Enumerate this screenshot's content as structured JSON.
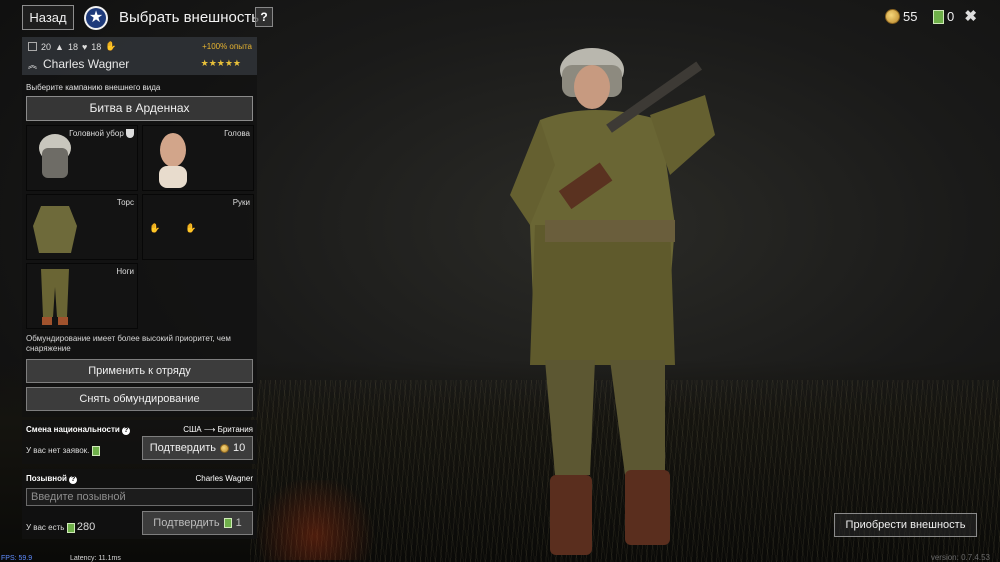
{
  "header": {
    "back_label": "Назад",
    "title": "Выбрать внешность",
    "help_label": "?",
    "gold": "55",
    "tickets": "0",
    "close_label": "✖"
  },
  "profile": {
    "stat1": "20",
    "stat2": "18",
    "stat3": "18",
    "exp_bonus": "+100% опыта",
    "name": "Charles Wagner",
    "rating": "★★★★★"
  },
  "appearance": {
    "campaign_label": "Выберите кампанию внешнего вида",
    "campaign_button": "Битва в Арденнах",
    "slots": [
      {
        "label": "Головной убор"
      },
      {
        "label": "Голова"
      },
      {
        "label": "Торс"
      },
      {
        "label": "Руки"
      },
      {
        "label": "Ноги"
      }
    ],
    "note": "Обмундирование имеет более высокий приоритет, чем снаряжение",
    "apply_button": "Применить к отряду",
    "remove_button": "Снять обмундирование"
  },
  "nationality": {
    "title": "Смена национальности",
    "from": "США",
    "to": "Британия",
    "no_orders": "У вас нет заявок.",
    "confirm": "Подтвердить",
    "cost": "10"
  },
  "callsign": {
    "title": "Позывной",
    "current": "Charles Wagner",
    "placeholder": "Введите позывной",
    "have_label": "У вас есть",
    "have_count": "280",
    "confirm": "Подтвердить",
    "cost": "1"
  },
  "buy_button": "Приобрести внешность",
  "debug": {
    "fps": "FPS: 59.9",
    "latency": "Latency: 11.1ms",
    "version": "version: 0.7.4.53"
  },
  "colors": {
    "accent_gold": "#e7b430",
    "rating_stars": "#e9c13a",
    "ticket_green": "#6fb04a"
  }
}
